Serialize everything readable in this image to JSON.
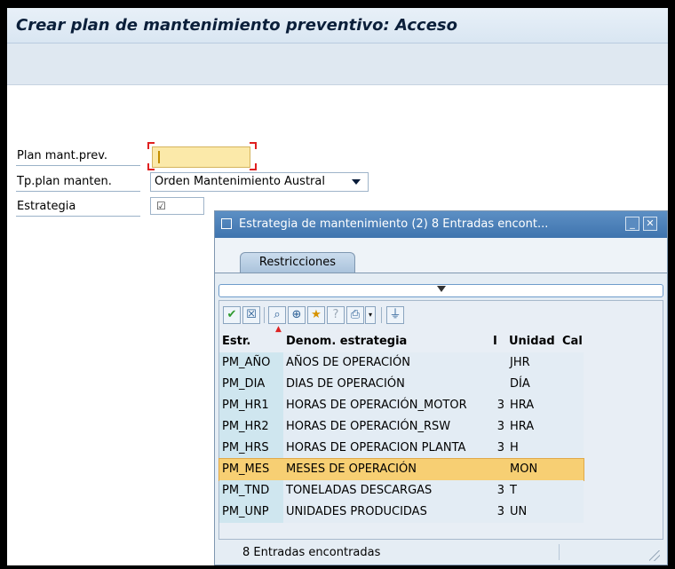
{
  "window": {
    "title": "Crear plan de mantenimiento preventivo: Acceso"
  },
  "form": {
    "plan_label": "Plan mant.prev.",
    "plan_value": "",
    "tipo_label": "Tp.plan manten.",
    "tipo_value": "Orden Mantenimiento Austral",
    "estrategia_label": "Estrategia"
  },
  "dialog": {
    "title": "Estrategia de mantenimiento (2)   8 Entradas encont...",
    "tab": "Restricciones",
    "columns": [
      "Estr.",
      "Denom. estrategia",
      "I",
      "Unidad",
      "Cal"
    ],
    "rows": [
      {
        "estr": "PM_AÑO",
        "denom": "AÑOS DE OPERACIÓN",
        "i": "",
        "unidad": "JHR"
      },
      {
        "estr": "PM_DIA",
        "denom": "DIAS DE OPERACIÓN",
        "i": "",
        "unidad": "DÍA"
      },
      {
        "estr": "PM_HR1",
        "denom": "HORAS DE OPERACIÓN_MOTOR",
        "i": "3",
        "unidad": "HRA"
      },
      {
        "estr": "PM_HR2",
        "denom": "HORAS DE OPERACIÓN_RSW",
        "i": "3",
        "unidad": "HRA"
      },
      {
        "estr": "PM_HRS",
        "denom": "HORAS DE OPERACION PLANTA",
        "i": "3",
        "unidad": "H"
      },
      {
        "estr": "PM_MES",
        "denom": "MESES DE OPERACIÓN",
        "i": "",
        "unidad": "MON"
      },
      {
        "estr": "PM_TND",
        "denom": "TONELADAS DESCARGAS",
        "i": "3",
        "unidad": "T"
      },
      {
        "estr": "PM_UNP",
        "denom": "UNIDADES PRODUCIDAS",
        "i": "3",
        "unidad": "UN"
      }
    ],
    "selected_row": "PM_MES",
    "status": "8 Entradas encontradas"
  },
  "colors": {
    "selected_row": "#f7cf73",
    "key_cell": "#cfe6ef",
    "row_bg": "#e3ecf4",
    "title_bar": "#4a80ba"
  },
  "icons": [
    "check-icon",
    "cancel-icon",
    "binoculars-icon",
    "find-next-icon",
    "favorite-add-icon",
    "help-icon",
    "print-icon",
    "dropdown-icon",
    "filter-icon"
  ]
}
